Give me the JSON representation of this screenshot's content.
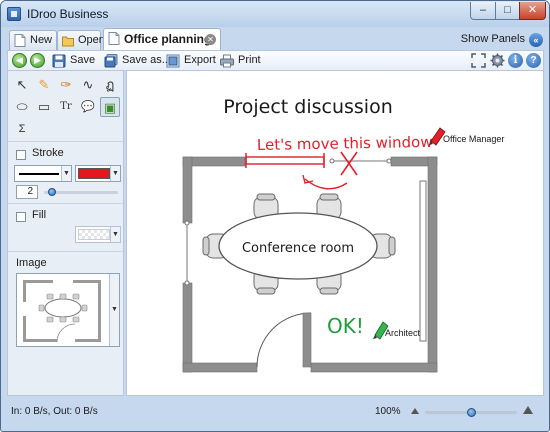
{
  "window": {
    "title": "IDroo Business",
    "minimize": "–",
    "maximize": "□",
    "close": "✕"
  },
  "tabs": [
    {
      "label": "New"
    },
    {
      "label": "Open"
    },
    {
      "label": "Office planning"
    }
  ],
  "tab_close_glyph": "✕",
  "show_panels": {
    "label": "Show Panels",
    "glyph": "«"
  },
  "toolbar": {
    "back_glyph": "◀",
    "forward_glyph": "▶",
    "save_label": "Save",
    "saveas_label": "Save as...",
    "export_label": "Export",
    "print_label": "Print"
  },
  "tools": [
    {
      "name": "select-tool",
      "glyph": "↖"
    },
    {
      "name": "pencil-tool",
      "glyph": "✎"
    },
    {
      "name": "highlighter-tool",
      "glyph": "✑"
    },
    {
      "name": "curve-tool",
      "glyph": "∿"
    },
    {
      "name": "spiral-tool",
      "glyph": "ฏ"
    },
    {
      "name": "ellipse-tool",
      "glyph": "⬭"
    },
    {
      "name": "rectangle-tool",
      "glyph": "▭"
    },
    {
      "name": "text-tool",
      "glyph": "Tr"
    },
    {
      "name": "callout-tool",
      "glyph": "💬"
    },
    {
      "name": "image-tool",
      "glyph": "▣"
    },
    {
      "name": "formula-tool",
      "glyph": "Σ"
    }
  ],
  "panel": {
    "stroke_label": "Stroke",
    "stroke_width": "2",
    "stroke_color": "#e8141e",
    "fill_label": "Fill",
    "image_label": "Image",
    "dropdown_glyph": "▼"
  },
  "canvas": {
    "title": "Project discussion",
    "room_label": "Conference room",
    "annotation_red": "Let's move this window",
    "role_office_manager": "Office Manager",
    "annotation_green": "OK!",
    "role_architect": "Architect",
    "red_ink": "#e0202a",
    "green_ink": "#1d9e3a"
  },
  "status": {
    "transfer": "In: 0 B/s, Out: 0 B/s",
    "zoom": "100%"
  },
  "icons": {
    "info": "i",
    "help": "?"
  },
  "colors": {
    "chrome": "#c5d8ee",
    "accent": "#2d6db3",
    "wall": "#8d8d8d"
  }
}
